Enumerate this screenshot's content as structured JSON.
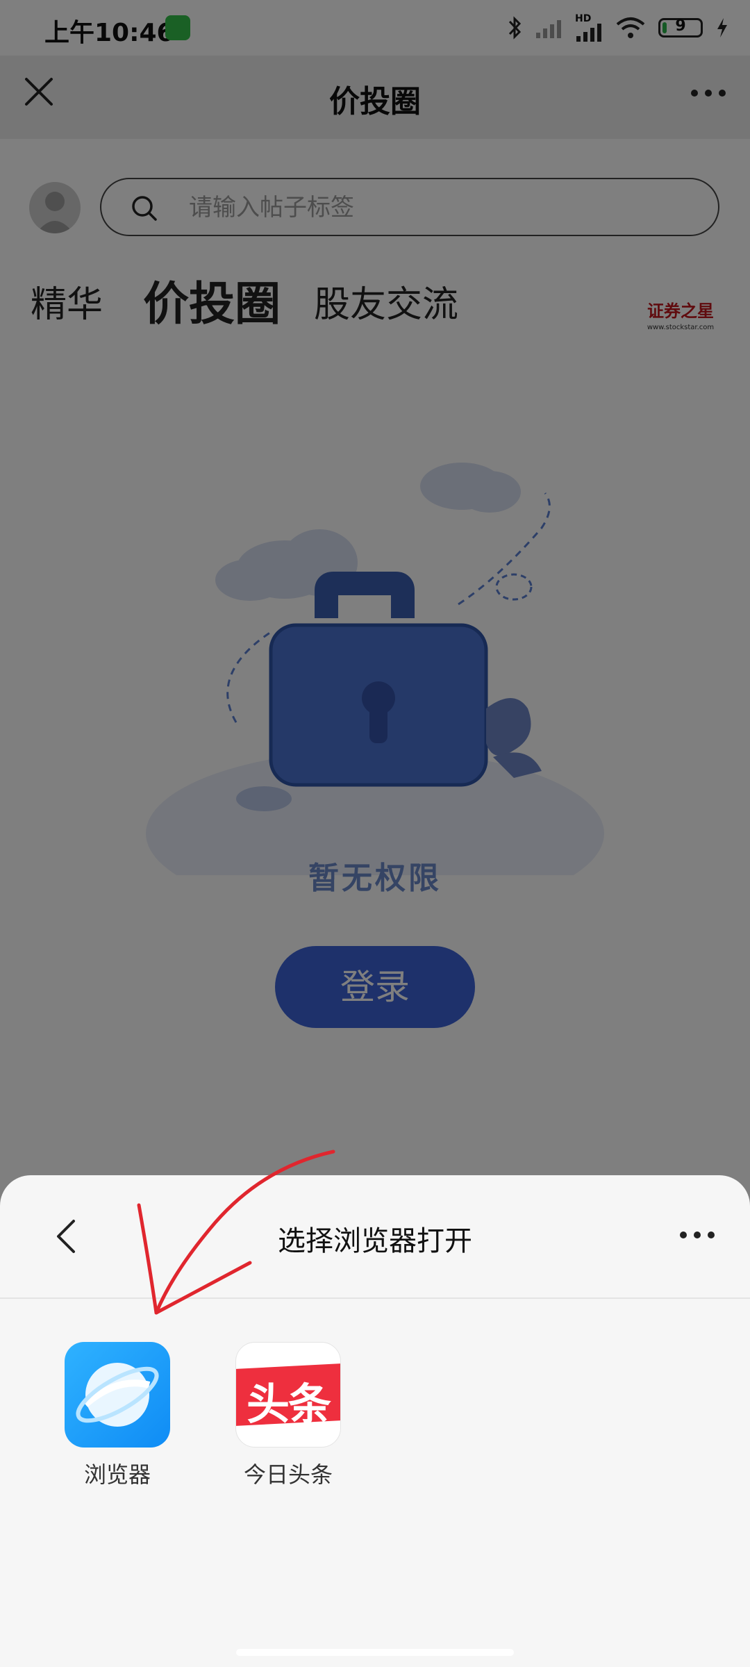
{
  "status_bar": {
    "time": "上午10:46",
    "network": "HD",
    "battery": "9"
  },
  "nav": {
    "title": "价投圈"
  },
  "search": {
    "placeholder": "请输入帖子标签"
  },
  "tabs": [
    {
      "label": "精华",
      "active": false
    },
    {
      "label": "价投圈",
      "active": true
    },
    {
      "label": "股友交流",
      "active": false
    }
  ],
  "brand": {
    "name": "证券之星",
    "url": "www.stockstar.com"
  },
  "empty_state": {
    "message": "暂无权限",
    "login_label": "登录"
  },
  "sheet": {
    "title": "选择浏览器打开",
    "apps": [
      {
        "label": "浏览器",
        "icon": "browser-icon"
      },
      {
        "label": "今日头条",
        "icon": "toutiao-icon",
        "icon_text": "头条"
      }
    ]
  },
  "colors": {
    "accent": "#3d63d6",
    "toutiao_red": "#ee2f3e",
    "browser_blue": "#1a9ef8",
    "annotation_red": "#e0262e"
  }
}
